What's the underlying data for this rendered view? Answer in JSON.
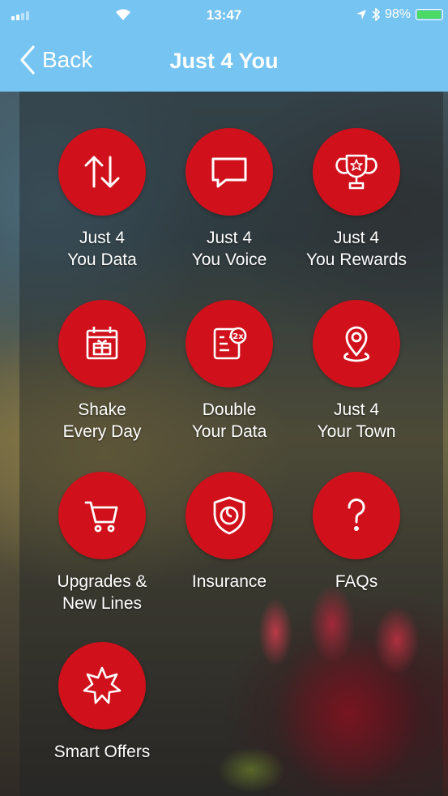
{
  "status_bar": {
    "time": "13:47",
    "battery_percent": "98%",
    "battery_level": 0.98
  },
  "nav": {
    "back_label": "Back",
    "title": "Just 4 You"
  },
  "colors": {
    "header": "#76c4f2",
    "tile": "#d0111b",
    "battery": "#4cd964"
  },
  "tiles": [
    {
      "label": "Just 4\nYou Data",
      "icon": "arrows-up-down-icon"
    },
    {
      "label": "Just 4\nYou Voice",
      "icon": "speech-bubble-icon"
    },
    {
      "label": "Just 4\nYou Rewards",
      "icon": "trophy-icon"
    },
    {
      "label": "Shake\nEvery Day",
      "icon": "calendar-gift-icon"
    },
    {
      "label": "Double\nYour Data",
      "icon": "double-data-icon"
    },
    {
      "label": "Just 4\nYour Town",
      "icon": "location-pin-icon"
    },
    {
      "label": "Upgrades &\nNew Lines",
      "icon": "shopping-cart-icon"
    },
    {
      "label": "Insurance",
      "icon": "shield-icon"
    },
    {
      "label": "FAQs",
      "icon": "question-mark-icon"
    },
    {
      "label": "Smart Offers",
      "icon": "starburst-icon"
    }
  ]
}
